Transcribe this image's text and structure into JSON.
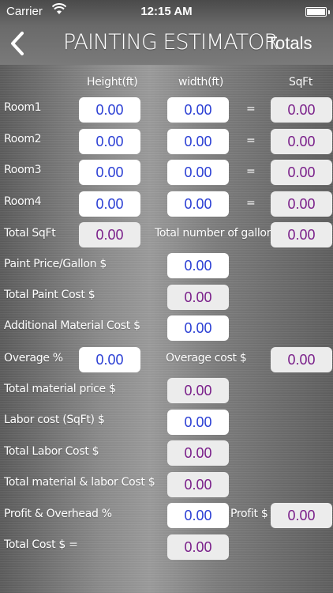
{
  "status": {
    "carrier": "Carrier",
    "time": "12:15 AM"
  },
  "nav": {
    "title": "PAINTING ESTIMATOR",
    "totals_label": "Totals"
  },
  "headers": {
    "height": "Height(ft)",
    "width": "width(ft)",
    "sqft": "SqFt"
  },
  "rooms": [
    {
      "label": "Room1",
      "height": "0.00",
      "width": "0.00",
      "sqft": "0.00"
    },
    {
      "label": "Room2",
      "height": "0.00",
      "width": "0.00",
      "sqft": "0.00"
    },
    {
      "label": "Room3",
      "height": "0.00",
      "width": "0.00",
      "sqft": "0.00"
    },
    {
      "label": "Room4",
      "height": "0.00",
      "width": "0.00",
      "sqft": "0.00"
    }
  ],
  "equals": "=",
  "total_sqft": {
    "label": "Total SqFt",
    "value": "0.00"
  },
  "total_gallon": {
    "label": "Total number of gallon",
    "value": "0.00"
  },
  "paint_price": {
    "label": "Paint Price/Gallon $",
    "value": "0.00"
  },
  "total_paint_cost": {
    "label": "Total Paint Cost $",
    "value": "0.00"
  },
  "additional_material": {
    "label": "Additional Material Cost $",
    "value": "0.00"
  },
  "overage_pct": {
    "label": "Overage %",
    "value": "0.00"
  },
  "overage_cost": {
    "label": "Overage cost $",
    "value": "0.00"
  },
  "total_material_price": {
    "label": "Total material price $",
    "value": "0.00"
  },
  "labor_cost": {
    "label": "Labor cost (SqFt) $",
    "value": "0.00"
  },
  "total_labor_cost": {
    "label": "Total Labor Cost $",
    "value": "0.00"
  },
  "total_material_labor": {
    "label": "Total material & labor Cost $",
    "value": "0.00"
  },
  "profit_overhead": {
    "label": "Profit & Overhead %",
    "value": "0.00"
  },
  "profit": {
    "label": "Profit $",
    "value": "0.00"
  },
  "total_cost": {
    "label": "Total Cost $ =",
    "value": "0.00"
  },
  "colors": {
    "input_text": "#2b3fd4",
    "output_text": "#7a1f8a"
  }
}
